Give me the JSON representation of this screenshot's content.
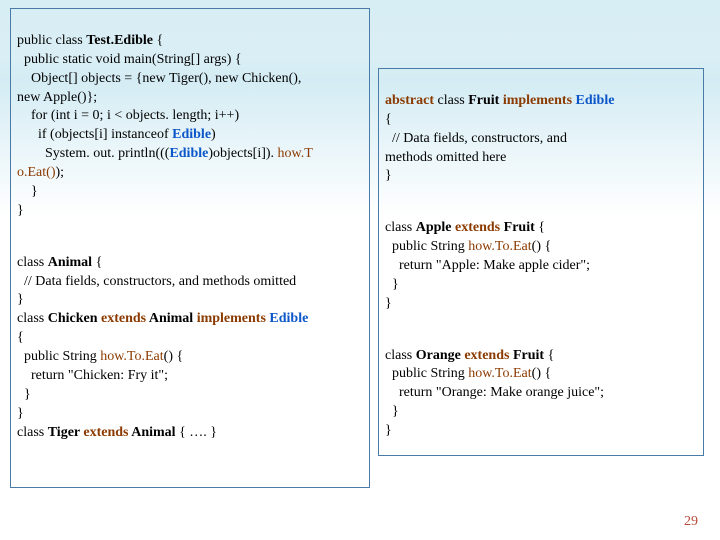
{
  "pageNumber": "29",
  "left": {
    "l1a": "public class ",
    "l1b": "Test.Edible",
    "l1c": " {",
    "l2": "  public static void main(String[] args) {",
    "l3": "    Object[] objects = {new Tiger(), new Chicken(),",
    "l4": "new Apple()};",
    "l5": "    for (int i = 0; i < objects. length; i++)",
    "l6a": "      if (objects[i] instanceof ",
    "l6b": "Edible",
    "l6c": ")",
    "l7a": "        System. out. println(((",
    "l7b": "Edible",
    "l7c": ")objects[i]). ",
    "l7d": "how.T",
    "l8a": "o.Eat()",
    "l8b": ");",
    "l9": "    }",
    "l10": "}",
    "l12a": "class ",
    "l12b": "Animal",
    "l12c": " {",
    "l13": "  // Data fields, constructors, and methods omitted",
    "l14": "}",
    "l15a": "class ",
    "l15b": "Chicken ",
    "l15c": "extends ",
    "l15d": "Animal ",
    "l15e": "implements ",
    "l15f": "Edible",
    "l16": "{",
    "l17a": "  public String ",
    "l17b": "how.To.Eat",
    "l17c": "() {",
    "l18": "    return \"Chicken: Fry it\";",
    "l19": "  }",
    "l20": "}",
    "l21a": "class ",
    "l21b": "Tiger ",
    "l21c": "extends ",
    "l21d": "Animal",
    "l21e": " { …. }"
  },
  "right": {
    "r1a": "abstract ",
    "r1b": "class ",
    "r1c": "Fruit ",
    "r1d": "implements ",
    "r1e": "Edible",
    "r2": "{",
    "r3": "  // Data fields, constructors, and",
    "r4": "methods omitted here",
    "r5": "}",
    "r7a": "class ",
    "r7b": "Apple ",
    "r7c": "extends ",
    "r7d": "Fruit",
    "r7e": " {",
    "r8a": "  public String ",
    "r8b": "how.To.Eat",
    "r8c": "() {",
    "r9": "    return \"Apple: Make apple cider\";",
    "r10": "  }",
    "r11": "}",
    "r13a": "class ",
    "r13b": "Orange ",
    "r13c": "extends ",
    "r13d": "Fruit",
    "r13e": " {",
    "r14a": "  public String ",
    "r14b": "how.To.Eat",
    "r14c": "() {",
    "r15": "    return \"Orange: Make orange juice\";",
    "r16": "  }",
    "r17": "}"
  }
}
